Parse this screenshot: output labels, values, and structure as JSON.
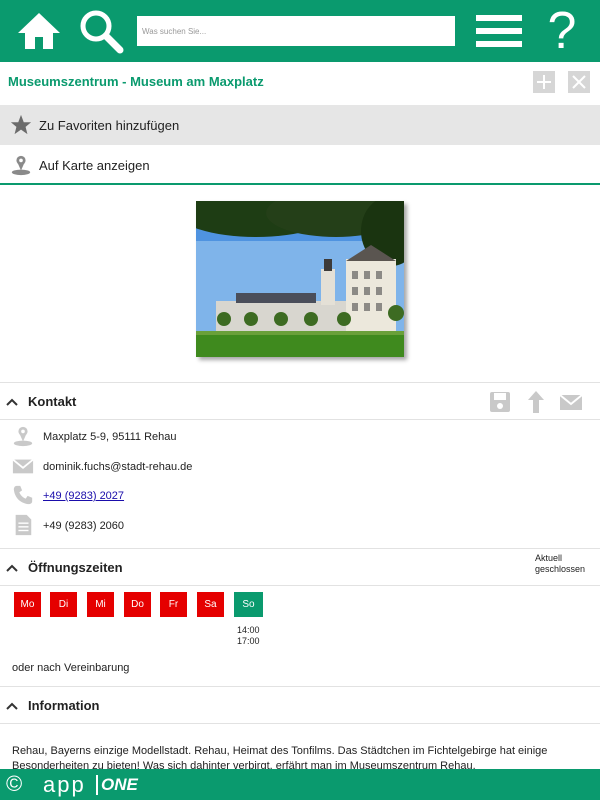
{
  "colors": {
    "brand": "#0a9a6e",
    "closed": "#e50000",
    "open": "#0a9a6e"
  },
  "header": {
    "search_placeholder": "Was suchen Sie...",
    "help_label": "?",
    "icons": [
      "home-icon",
      "search-icon",
      "menu-icon",
      "help-icon"
    ]
  },
  "page": {
    "title": "Museumszentrum - Museum am Maxplatz",
    "favorite_label": "Zu Favoriten hinzufügen",
    "map_label": "Auf Karte anzeigen"
  },
  "kontakt": {
    "title": "Kontakt",
    "address": "Maxplatz 5-9, 95111 Rehau",
    "email": "dominik.fuchs@stadt-rehau.de",
    "phone": "+49 (9283) 2027",
    "fax": "+49 (9283) 2060"
  },
  "hours": {
    "title": "Öffnungszeiten",
    "status_line1": "Aktuell",
    "status_line2": "geschlossen",
    "days": [
      {
        "label": "Mo",
        "open": false
      },
      {
        "label": "Di",
        "open": false
      },
      {
        "label": "Mi",
        "open": false
      },
      {
        "label": "Do",
        "open": false
      },
      {
        "label": "Fr",
        "open": false
      },
      {
        "label": "Sa",
        "open": false
      },
      {
        "label": "So",
        "open": true
      }
    ],
    "sunday_from": "14:00",
    "sunday_to": "17:00",
    "note": "oder nach Vereinbarung"
  },
  "information": {
    "title": "Information",
    "text": "Rehau, Bayerns einzige Modellstadt. Rehau, Heimat des Tonfilms. Das Städtchen im Fichtelgebirge hat einige Besonderheiten zu bieten! Was sich dahinter verbirgt, erfährt man im Museumszentrum Rehau."
  },
  "footer": {
    "copyright": "©",
    "brand_light": "app",
    "brand_bold": "ONE"
  }
}
